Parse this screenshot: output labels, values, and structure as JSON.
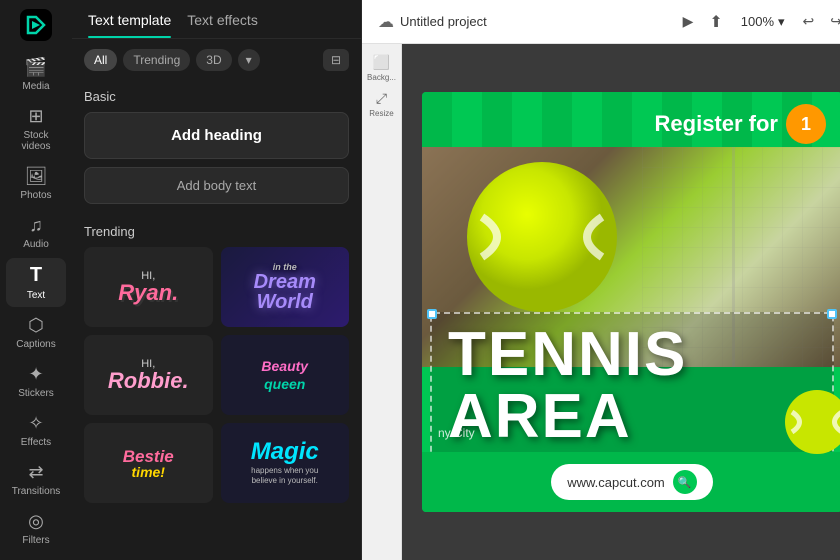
{
  "sidebar": {
    "items": [
      {
        "id": "media",
        "label": "Media",
        "icon": "🎬"
      },
      {
        "id": "stock-videos",
        "label": "Stock videos",
        "icon": "▦"
      },
      {
        "id": "photos",
        "label": "Photos",
        "icon": "🖼"
      },
      {
        "id": "audio",
        "label": "Audio",
        "icon": "🎵"
      },
      {
        "id": "text",
        "label": "Text",
        "icon": "T",
        "active": true
      },
      {
        "id": "captions",
        "label": "Captions",
        "icon": "💬"
      },
      {
        "id": "stickers",
        "label": "Stickers",
        "icon": "⭐"
      },
      {
        "id": "effects",
        "label": "Effects",
        "icon": "✨"
      },
      {
        "id": "transitions",
        "label": "Transitions",
        "icon": "↔"
      },
      {
        "id": "filters",
        "label": "Filters",
        "icon": "◎"
      }
    ]
  },
  "panel": {
    "tabs": [
      {
        "id": "text-template",
        "label": "Text template",
        "active": true
      },
      {
        "id": "text-effects",
        "label": "Text effects"
      }
    ],
    "filters": [
      {
        "id": "all",
        "label": "All",
        "active": true
      },
      {
        "id": "trending",
        "label": "Trending"
      },
      {
        "id": "3d",
        "label": "3D"
      }
    ],
    "sections": {
      "basic": {
        "title": "Basic",
        "add_heading": "Add heading",
        "add_body": "Add body text"
      },
      "trending": {
        "title": "Trending",
        "items": [
          {
            "id": "hi-ryan",
            "type": "hi-ryan"
          },
          {
            "id": "dream-world",
            "type": "dream-world"
          },
          {
            "id": "hi-robbie",
            "type": "hi-robbie"
          },
          {
            "id": "beauty-queen",
            "type": "beauty-queen"
          },
          {
            "id": "bestie-time",
            "type": "bestie-time"
          },
          {
            "id": "magic",
            "type": "magic"
          }
        ]
      }
    }
  },
  "editor": {
    "project_title": "Untitled project",
    "zoom_level": "100%",
    "canvas": {
      "register_text": "Register for",
      "main_text_line1": "TENNIS",
      "main_text_line2": "AREA",
      "city_text": "ny City",
      "url_text": "www.capcut.com"
    }
  },
  "icons": {
    "play": "▶",
    "export": "⬆",
    "undo": "↩",
    "redo": "↪",
    "cloud": "☁",
    "chevron_down": "▾",
    "filter": "⊞",
    "search": "🔍",
    "bg_icon": "⬜",
    "resize_icon": "⤢"
  }
}
